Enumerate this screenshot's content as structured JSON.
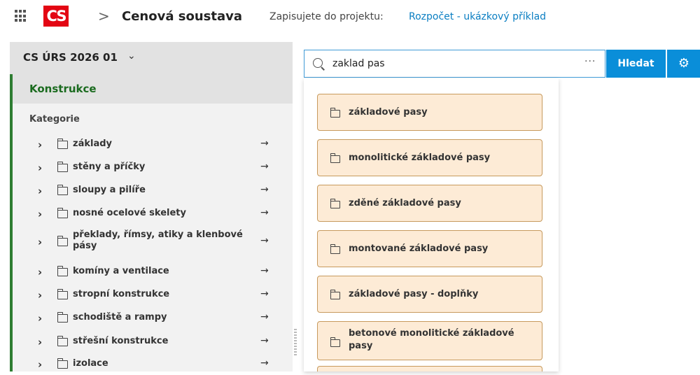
{
  "header": {
    "logo": "CS",
    "breadcrumb_arrow": ">",
    "title": "Cenová soustava",
    "project_label": "Zapisujete do projektu:",
    "project_name": "Rozpočet - ukázkový příklad"
  },
  "sidebar": {
    "version": "CS ÚRS 2026 01",
    "section": "Konstrukce",
    "category_label": "Kategorie",
    "items": [
      {
        "label": "základy"
      },
      {
        "label": "stěny a příčky"
      },
      {
        "label": "sloupy a pilíře"
      },
      {
        "label": "nosné ocelové skelety"
      },
      {
        "label": "překlady, římsy, atiky a klenbové pásy"
      },
      {
        "label": "komíny a ventilace"
      },
      {
        "label": "stropní konstrukce"
      },
      {
        "label": "schodiště a rampy"
      },
      {
        "label": "střešní konstrukce"
      },
      {
        "label": "izolace"
      }
    ]
  },
  "search": {
    "value": "zaklad pas",
    "more": "···",
    "button_label": "Hledat"
  },
  "results": [
    {
      "label": "základové pasy"
    },
    {
      "label": "monolitické základové pasy"
    },
    {
      "label": "zděné základové pasy"
    },
    {
      "label": "montované základové pasy"
    },
    {
      "label": "základové pasy - doplňky"
    },
    {
      "label": "betonové monolitické základové pasy"
    }
  ],
  "colors": {
    "accent": "#0a8ed9",
    "brand": "#e30613",
    "section_green": "#1b6b1f",
    "card_bg": "#fdebd6"
  },
  "icons": {
    "apps": "apps-grid-icon",
    "search": "search-icon",
    "settings": "gear-icon",
    "folder": "folder-icon",
    "expand": "chevron-right-icon",
    "go": "arrow-right-icon"
  }
}
